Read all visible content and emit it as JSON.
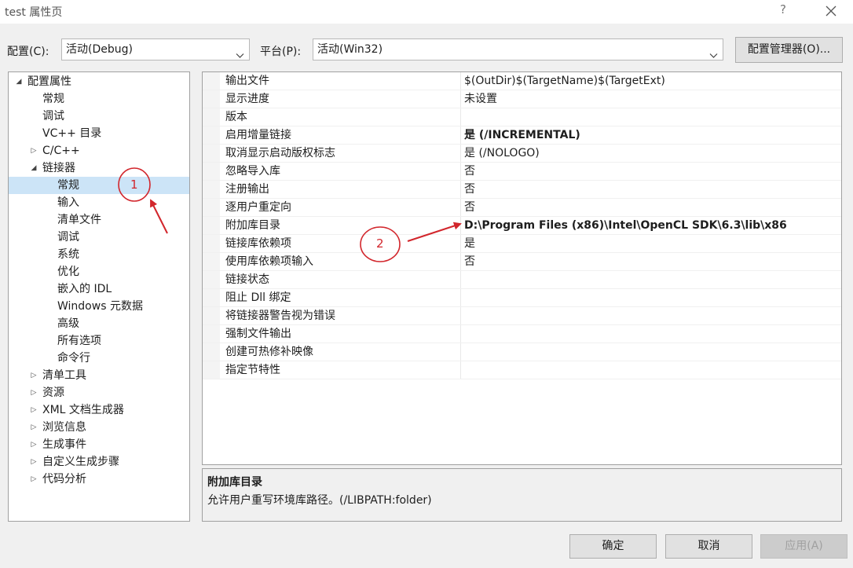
{
  "window": {
    "title": "test 属性页",
    "help_label": "?"
  },
  "toolbar": {
    "config_label": "配置(C):",
    "config_value": "活动(Debug)",
    "platform_label": "平台(P):",
    "platform_value": "活动(Win32)",
    "config_manager_label": "配置管理器(O)..."
  },
  "tree": {
    "items": [
      {
        "label": "配置属性",
        "expander": "◢"
      },
      {
        "label": "常规",
        "expander": ""
      },
      {
        "label": "调试",
        "expander": ""
      },
      {
        "label": "VC++ 目录",
        "expander": ""
      },
      {
        "label": "C/C++",
        "expander": "▷"
      },
      {
        "label": "链接器",
        "expander": "◢"
      },
      {
        "label": "常规",
        "expander": "",
        "selected": true
      },
      {
        "label": "输入",
        "expander": ""
      },
      {
        "label": "清单文件",
        "expander": ""
      },
      {
        "label": "调试",
        "expander": ""
      },
      {
        "label": "系统",
        "expander": ""
      },
      {
        "label": "优化",
        "expander": ""
      },
      {
        "label": "嵌入的 IDL",
        "expander": ""
      },
      {
        "label": "Windows 元数据",
        "expander": ""
      },
      {
        "label": "高级",
        "expander": ""
      },
      {
        "label": "所有选项",
        "expander": ""
      },
      {
        "label": "命令行",
        "expander": ""
      },
      {
        "label": "清单工具",
        "expander": "▷"
      },
      {
        "label": "资源",
        "expander": "▷"
      },
      {
        "label": "XML 文档生成器",
        "expander": "▷"
      },
      {
        "label": "浏览信息",
        "expander": "▷"
      },
      {
        "label": "生成事件",
        "expander": "▷"
      },
      {
        "label": "自定义生成步骤",
        "expander": "▷"
      },
      {
        "label": "代码分析",
        "expander": "▷"
      }
    ]
  },
  "properties": {
    "rows": [
      {
        "name": "输出文件",
        "value": "$(OutDir)$(TargetName)$(TargetExt)"
      },
      {
        "name": "显示进度",
        "value": "未设置"
      },
      {
        "name": "版本",
        "value": ""
      },
      {
        "name": "启用增量链接",
        "value": "是 (/INCREMENTAL)",
        "bold": true
      },
      {
        "name": "取消显示启动版权标志",
        "value": "是 (/NOLOGO)"
      },
      {
        "name": "忽略导入库",
        "value": "否"
      },
      {
        "name": "注册输出",
        "value": "否"
      },
      {
        "name": "逐用户重定向",
        "value": "否"
      },
      {
        "name": "附加库目录",
        "value": "D:\\Program Files (x86)\\Intel\\OpenCL SDK\\6.3\\lib\\x86",
        "bold": true
      },
      {
        "name": "链接库依赖项",
        "value": "是"
      },
      {
        "name": "使用库依赖项输入",
        "value": "否"
      },
      {
        "name": "链接状态",
        "value": ""
      },
      {
        "name": "阻止 Dll 绑定",
        "value": ""
      },
      {
        "name": "将链接器警告视为错误",
        "value": ""
      },
      {
        "name": "强制文件输出",
        "value": ""
      },
      {
        "name": "创建可热修补映像",
        "value": ""
      },
      {
        "name": "指定节特性",
        "value": ""
      }
    ]
  },
  "description": {
    "title": "附加库目录",
    "text": "允许用户重写环境库路径。(/LIBPATH:folder)"
  },
  "buttons": {
    "ok": "确定",
    "cancel": "取消",
    "apply": "应用(A)"
  },
  "annotations": {
    "marker1": "1",
    "marker2": "2",
    "color": "#d2262c"
  },
  "colors": {
    "selection": "#cce4f7",
    "disabled_text": "#a0a0a0"
  }
}
